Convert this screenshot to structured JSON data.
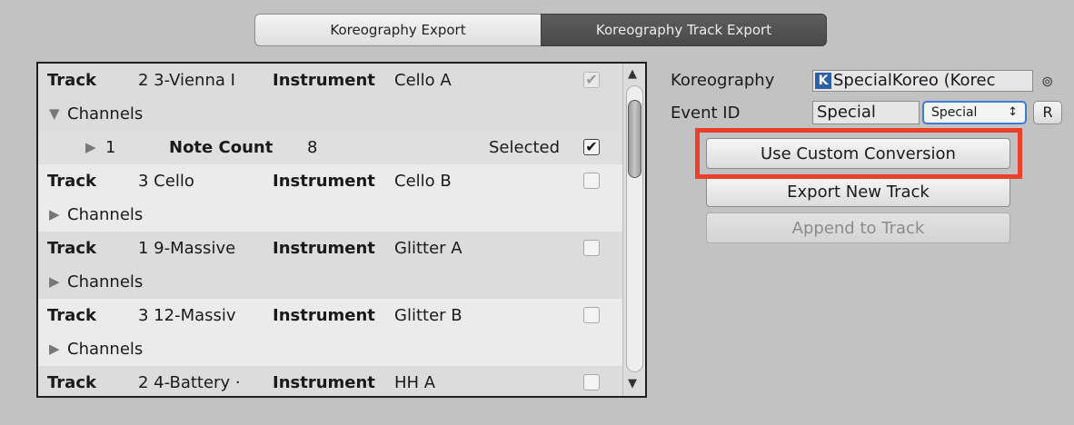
{
  "tabs": [
    {
      "label": "Koreography Export",
      "active": false
    },
    {
      "label": "Koreography Track Export",
      "active": true
    }
  ],
  "tracks": [
    {
      "track_label": "Track",
      "track_value": "2 3-Vienna I",
      "instrument_label": "Instrument",
      "instrument_value": "Cello A",
      "channels_label": "Channels",
      "checked": true,
      "expanded": true,
      "channel": {
        "index": "1",
        "note_count_label": "Note Count",
        "note_count": "8",
        "selected_label": "Selected",
        "selected": true
      }
    },
    {
      "track_label": "Track",
      "track_value": "3 Cello",
      "instrument_label": "Instrument",
      "instrument_value": "Cello B",
      "channels_label": "Channels",
      "checked": false,
      "expanded": false
    },
    {
      "track_label": "Track",
      "track_value": "1 9-Massive",
      "instrument_label": "Instrument",
      "instrument_value": "Glitter A",
      "channels_label": "Channels",
      "checked": false,
      "expanded": false
    },
    {
      "track_label": "Track",
      "track_value": "3 12-Massiv",
      "instrument_label": "Instrument",
      "instrument_value": "Glitter B",
      "channels_label": "Channels",
      "checked": false,
      "expanded": false
    },
    {
      "track_label": "Track",
      "track_value": "2 4-Battery ·",
      "instrument_label": "Instrument",
      "instrument_value": "HH A",
      "checked": false
    }
  ],
  "icons": {
    "expanded": "triangle-down-icon",
    "collapsed": "triangle-right-icon",
    "check": "checkmark-icon",
    "scroll_up": "arrow-up-icon",
    "scroll_down": "arrow-down-icon",
    "object_picker": "target-icon",
    "koreo": "koreography-asset-icon"
  },
  "glyphs": {
    "expanded": "▼",
    "collapsed": "▶",
    "check": "✔",
    "up": "▲",
    "down": "▼",
    "picker": "⊚",
    "caret": "↕",
    "koreo": "K"
  },
  "right_panel": {
    "koreography_label": "Koreography",
    "koreography_value": "SpecialKoreo (Korec",
    "event_id_label": "Event ID",
    "event_id_value": "Special",
    "event_id_select": "Special",
    "reset_label": "R",
    "use_custom_conversion": "Use Custom Conversion",
    "export_new_track": "Export New Track",
    "append_to_track": "Append to Track"
  },
  "colors": {
    "highlight": "#e8402b",
    "select_border": "#3d7bd6",
    "active_tab": "#4f4f4f"
  }
}
